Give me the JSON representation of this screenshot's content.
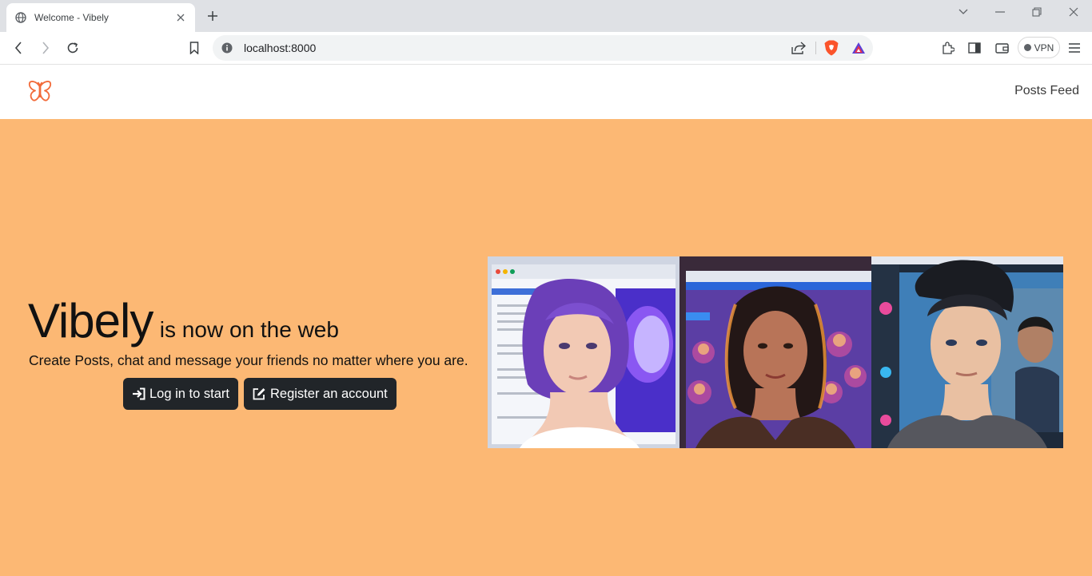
{
  "browser": {
    "tab_title": "Welcome - Vibely",
    "url": "localhost:8000",
    "vpn_label": "VPN"
  },
  "navbar": {
    "brand_icon": "butterfly-icon",
    "brand_color": "#f26b3a",
    "link_label": "Posts Feed"
  },
  "hero": {
    "background": "#fcb874",
    "title_big": "Vibely",
    "title_rest": "is now on the web",
    "subtitle": "Create Posts, chat and message your friends no matter where you are.",
    "login_label": "Log in to start",
    "register_label": "Register an account",
    "button_color": "#212529"
  }
}
